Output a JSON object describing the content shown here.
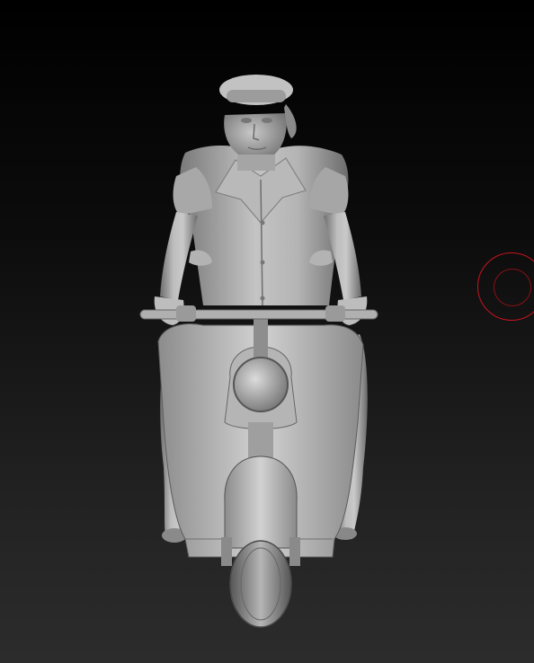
{
  "viewport": {
    "background_top": "#000000",
    "background_bottom": "#2c2c2c"
  },
  "model": {
    "subject": "scooter-riders-sculpt",
    "material_base": "#a9a9a9",
    "material_highlight": "#d6d6d6",
    "material_shadow": "#5e5e5e"
  },
  "brush_cursor": {
    "color": "#c8141c",
    "icon": "circle-brush-cursor"
  }
}
